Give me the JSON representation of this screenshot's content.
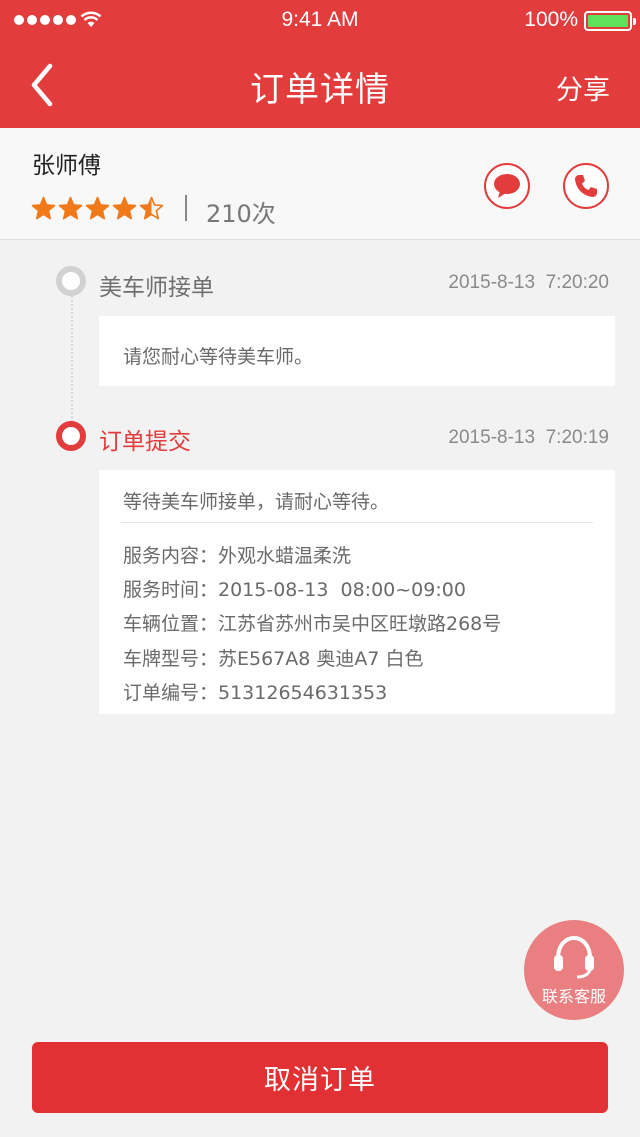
{
  "status_bar": {
    "time": "9:41 AM",
    "battery": "100%"
  },
  "nav": {
    "title": "订单详情",
    "share_label": "分享",
    "back_icon": "chevron-left-icon"
  },
  "driver": {
    "name": "张师傅",
    "rating": 4.5,
    "rating_max": 5,
    "order_count": "210次",
    "message_icon": "chat-bubble-icon",
    "call_icon": "phone-icon"
  },
  "timeline": [
    {
      "title": "美车师接单",
      "time": "2015-8-13  7:20:20",
      "message": "请您耐心等待美车师。",
      "status": "past"
    },
    {
      "title": "订单提交",
      "time": "2015-8-13  7:20:19",
      "message": "等待美车师接单，请耐心等待。",
      "status": "current",
      "details": [
        "服务内容：外观水蜡温柔洗",
        "服务时间：2015-08-13  08:00~09:00",
        "车辆位置：江苏省苏州市吴中区旺墩路268号",
        "车牌型号：苏E567A8 奥迪A7 白色",
        "订单编号：51312654631353"
      ]
    }
  ],
  "support": {
    "label": "联系客服",
    "icon": "headset-icon"
  },
  "cancel_label": "取消订单",
  "colors": {
    "brand_red": "#e23c3c",
    "star_orange": "#f07a1a",
    "support_pink": "#e97f81",
    "battery_green": "#5fe15a"
  }
}
